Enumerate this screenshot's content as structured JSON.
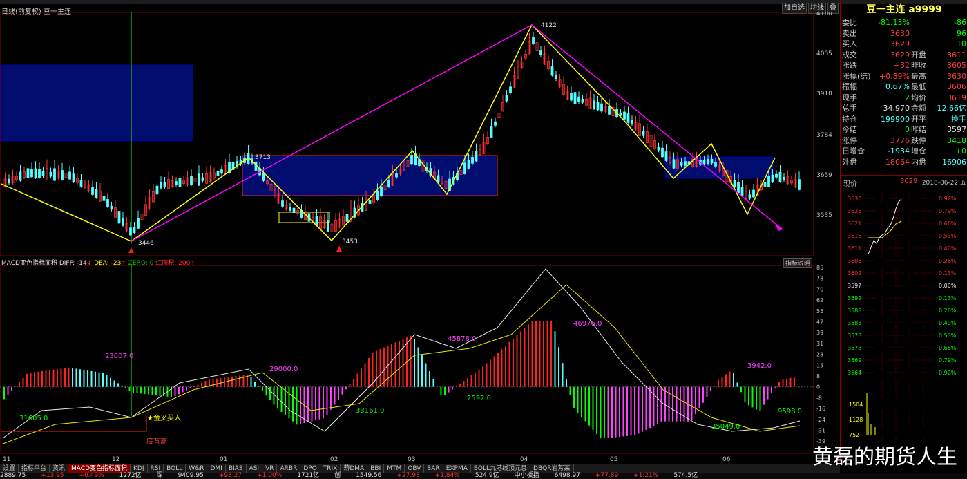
{
  "window": {
    "title": "日线(前复权) 豆一主连",
    "buttons": [
      "加自选",
      "均线",
      "叠"
    ]
  },
  "main_chart": {
    "y_ticks": [
      "4160",
      "4035",
      "3910",
      "3784",
      "3659",
      "3535"
    ],
    "annotations": {
      "high": "4122",
      "low1": "3446",
      "low2": "3453",
      "mid": "3713"
    }
  },
  "macd": {
    "header": "MACD变色指标面积 DIFF: -14",
    "dea": "DEA: -23",
    "zero": "ZERO: 0",
    "red_area": "红面积: 200",
    "help": "指标说明",
    "y_ticks": [
      "85",
      "78",
      "70",
      "62",
      "55",
      "47",
      "39",
      "31",
      "23",
      "15",
      "8",
      "0",
      "-8",
      "-16",
      "-24",
      "-31",
      "-39"
    ],
    "areas": [
      "23007.0",
      "29000.0",
      "45878.0",
      "46976.0",
      "3942.0",
      "31605.0",
      "33161.0",
      "2592.0",
      "35049.0",
      "9598.0"
    ],
    "signal": "金叉买入",
    "divergence": "底背离"
  },
  "x_axis": [
    "11",
    "12",
    "01",
    "02",
    "03",
    "04",
    "05",
    "06"
  ],
  "quote": {
    "title": "豆一主连 a9999",
    "rows": [
      {
        "l": "委比",
        "v": "-81.13%",
        "c": "green",
        "l2": "",
        "v2": "-86",
        "c2": "green"
      },
      {
        "l": "卖出",
        "v": "3630",
        "c": "red",
        "l2": "",
        "v2": "96",
        "c2": "green"
      },
      {
        "l": "买入",
        "v": "3629",
        "c": "red",
        "l2": "",
        "v2": "10",
        "c2": "green"
      },
      {
        "l": "成交",
        "v": "3629",
        "c": "red",
        "l2": "开盘",
        "v2": "3611",
        "c2": "red"
      },
      {
        "l": "涨跌",
        "v": "+32",
        "c": "red",
        "l2": "昨收",
        "v2": "3605",
        "c2": "red"
      },
      {
        "l": "涨幅(结)",
        "v": "+0.89%",
        "c": "red",
        "l2": "最高",
        "v2": "3630",
        "c2": "red"
      },
      {
        "l": "振幅",
        "v": "0.67%",
        "c": "cyan",
        "l2": "最低",
        "v2": "3606",
        "c2": "red"
      },
      {
        "l": "现手",
        "v": "2",
        "c": "green",
        "l2": "均价",
        "v2": "3619",
        "c2": "red"
      },
      {
        "l": "总手",
        "v": "34,970",
        "c": "white",
        "l2": "金额",
        "v2": "12.66亿",
        "c2": "cyan"
      },
      {
        "l": "持仓",
        "v": "199900",
        "c": "cyan",
        "l2": "开平",
        "v2": "换手",
        "c2": "cyan"
      },
      {
        "l": "今结",
        "v": "0",
        "c": "green",
        "l2": "昨结",
        "v2": "3597",
        "c2": "white"
      },
      {
        "l": "涨停",
        "v": "3776",
        "c": "red",
        "l2": "跌停",
        "v2": "3418",
        "c2": "green"
      },
      {
        "l": "日增仓",
        "v": "-1934",
        "c": "cyan",
        "l2": "增仓",
        "v2": "+0",
        "c2": "green"
      },
      {
        "l": "外盘",
        "v": "18064",
        "c": "red",
        "l2": "内盘",
        "v2": "16906",
        "c2": "cyan"
      }
    ],
    "now_label": "现价",
    "now_value": "3629",
    "date": "2018-06-22,五",
    "intraday_prices": [
      "3630",
      "3625",
      "3621",
      "3616",
      "3611",
      "3606",
      "3602",
      "3597",
      "3592",
      "3588",
      "3583",
      "3578",
      "3573",
      "3569",
      "3564"
    ],
    "intraday_pcts": [
      "0.92%",
      "0.79%",
      "0.66%",
      "0.53%",
      "0.40%",
      "0.26%",
      "0.13%",
      "0.00%",
      "0.13%",
      "0.26%",
      "0.40%",
      "0.53%",
      "0.66%",
      "0.79%",
      "0.92%"
    ],
    "vol_ticks": [
      "1504",
      "1128",
      "752"
    ]
  },
  "tabs": [
    "设置",
    "指标平台",
    "资讯",
    "MACD变色指标面积",
    "KDJ",
    "RSI",
    "BOLL",
    "W&R",
    "DMI",
    "BIAS",
    "ASI",
    "VR",
    "ARBR",
    "DPO",
    "TRIX",
    "薪DMA",
    "BBI",
    "MTM",
    "OBV",
    "SAR",
    "EXPMA",
    "BOLL九港线顶元息",
    "DBQR岩芳莱"
  ],
  "status": [
    "2889.75",
    "+13.95",
    "+0.49%",
    "1272亿",
    "深",
    "9409.95",
    "+93.27",
    "+1.00%",
    "1721亿",
    "创",
    "1549.56",
    "+27.98",
    "+1.84%",
    "524.9亿",
    "中小板指",
    "6498.97",
    "+77.89",
    "+1.21%",
    "574.5亿"
  ],
  "watermark": "黄磊的期货人生",
  "colors": {
    "up": "#ff3232",
    "down": "#54ffff",
    "bg": "#000000",
    "grid": "#800000",
    "accent": "#ffff54"
  }
}
